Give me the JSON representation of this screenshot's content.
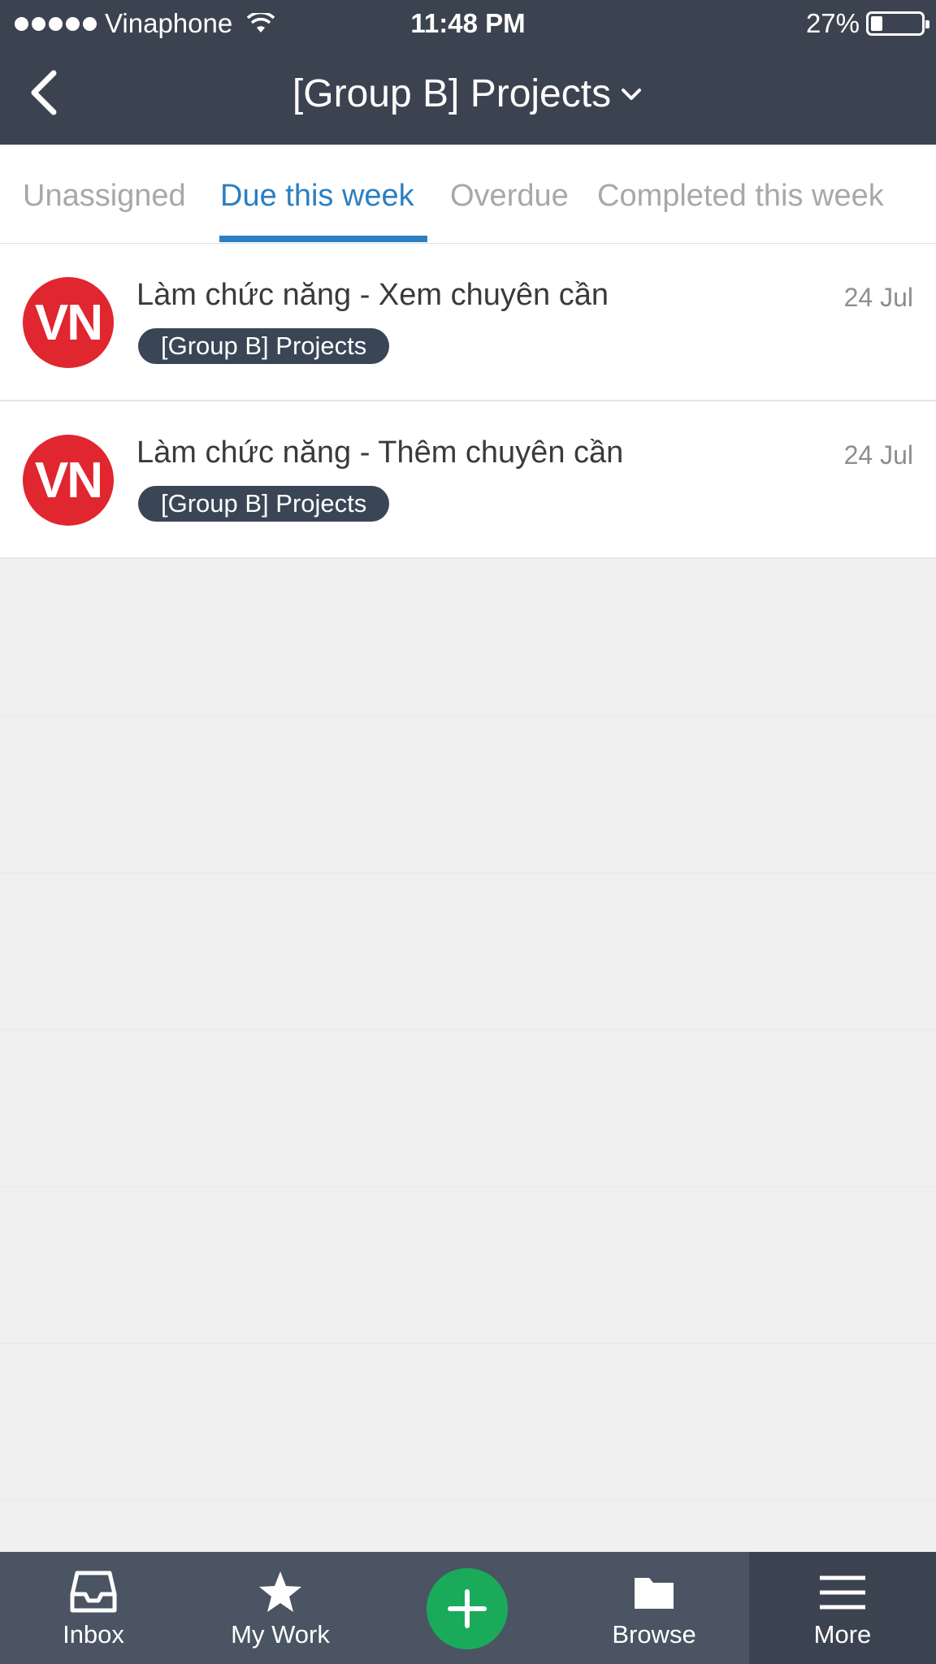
{
  "status_bar": {
    "carrier": "Vinaphone",
    "time": "11:48 PM",
    "battery": "27%",
    "battery_level": 0.27
  },
  "nav": {
    "title": "[Group B] Projects"
  },
  "tabs": [
    {
      "label": "Unassigned",
      "active": false
    },
    {
      "label": "Due this week",
      "active": true
    },
    {
      "label": "Overdue",
      "active": false
    },
    {
      "label": "Completed this week",
      "active": false
    }
  ],
  "tasks": [
    {
      "avatar": "VN",
      "title": "Làm chức năng - Xem chuyên cần",
      "tag": "[Group B] Projects",
      "date": "24 Jul"
    },
    {
      "avatar": "VN",
      "title": "Làm chức năng - Thêm chuyên cần",
      "tag": "[Group B] Projects",
      "date": "24 Jul"
    }
  ],
  "tab_bar": {
    "inbox": "Inbox",
    "my_work": "My Work",
    "browse": "Browse",
    "more": "More"
  },
  "colors": {
    "header_bg": "#3c4350",
    "accent": "#2b7fc2",
    "avatar_bg": "#e0262f",
    "add_button": "#1aab5a"
  }
}
